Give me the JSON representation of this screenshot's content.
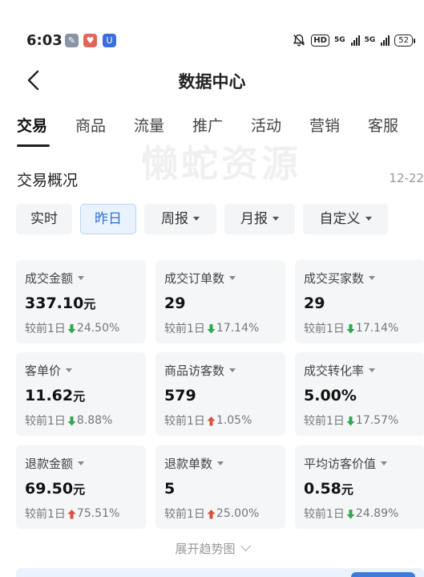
{
  "status_bar": {
    "time": "6:03",
    "hd_label": "HD",
    "signal_1_label": "5G",
    "signal_2_label": "5G",
    "battery": "52"
  },
  "nav": {
    "title": "数据中心",
    "back_icon": "chevron-left-icon"
  },
  "tabs": [
    {
      "label": "交易",
      "active": true
    },
    {
      "label": "商品"
    },
    {
      "label": "流量"
    },
    {
      "label": "推广"
    },
    {
      "label": "活动"
    },
    {
      "label": "营销"
    },
    {
      "label": "客服"
    }
  ],
  "watermark": "懒蛇资源",
  "overview": {
    "title": "交易概况",
    "date": "12-22"
  },
  "filters": [
    {
      "label": "实时"
    },
    {
      "label": "昨日",
      "active": true
    },
    {
      "label": "周报"
    },
    {
      "label": "月报"
    },
    {
      "label": "自定义"
    }
  ],
  "metrics": [
    {
      "label": "成交金额",
      "value": "337.10",
      "unit": "元",
      "compare_prefix": "较前1日",
      "direction": "down",
      "change": "24.50%"
    },
    {
      "label": "成交订单数",
      "value": "29",
      "unit": "",
      "compare_prefix": "较前1日",
      "direction": "down",
      "change": "17.14%"
    },
    {
      "label": "成交买家数",
      "value": "29",
      "unit": "",
      "compare_prefix": "较前1日",
      "direction": "down",
      "change": "17.14%"
    },
    {
      "label": "客单价",
      "value": "11.62",
      "unit": "元",
      "compare_prefix": "较前1日",
      "direction": "down",
      "change": "8.88%"
    },
    {
      "label": "商品访客数",
      "value": "579",
      "unit": "",
      "compare_prefix": "较前1日",
      "direction": "up",
      "change": "1.05%"
    },
    {
      "label": "成交转化率",
      "value": "5.00%",
      "unit": "",
      "compare_prefix": "较前1日",
      "direction": "down",
      "change": "17.57%"
    },
    {
      "label": "退款金额",
      "value": "69.50",
      "unit": "元",
      "compare_prefix": "较前1日",
      "direction": "up",
      "change": "75.51%"
    },
    {
      "label": "退款单数",
      "value": "5",
      "unit": "",
      "compare_prefix": "较前1日",
      "direction": "up",
      "change": "25.00%"
    },
    {
      "label": "平均访客价值",
      "value": "0.58",
      "unit": "元",
      "compare_prefix": "较前1日",
      "direction": "down",
      "change": "24.89%"
    }
  ],
  "colors": {
    "down": "#2fa84f",
    "up": "#d9503f",
    "active": "#2a6fd6"
  },
  "expand_label": "展开趋势图"
}
